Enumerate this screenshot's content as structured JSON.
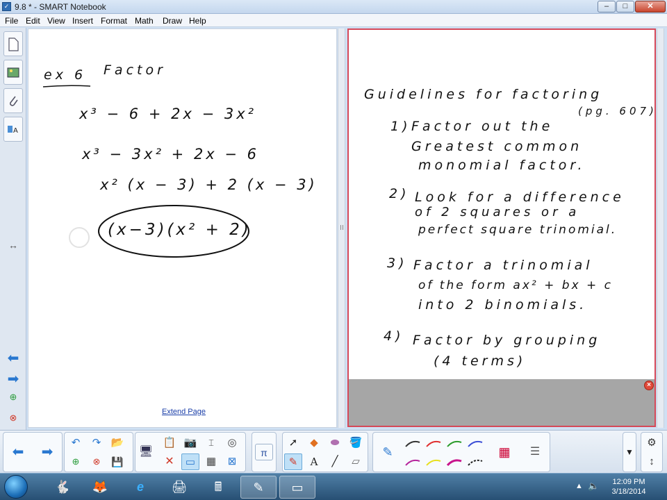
{
  "window": {
    "title": "9.8 * - SMART Notebook"
  },
  "menu": [
    "File",
    "Edit",
    "View",
    "Insert",
    "Format",
    "Math",
    "Draw",
    "Help"
  ],
  "left_page": {
    "ex_label": "ex 6",
    "factor_label": "Factor",
    "line1": "x³ − 6 + 2x − 3x²",
    "line2": "x³ − 3x² + 2x − 6",
    "line3": "x² (x − 3) + 2 (x − 3)",
    "answer": "(x−3)(x² + 2)",
    "extend_link": "Extend Page"
  },
  "right_page": {
    "heading": "Guidelines for factoring",
    "ref": "(pg. 607)",
    "items": [
      {
        "num": "1)",
        "lines": [
          "Factor out the",
          "Greatest common",
          "monomial factor."
        ]
      },
      {
        "num": "2)",
        "lines": [
          "Look for a difference",
          "of 2 squares or a",
          "perfect square trinomial."
        ]
      },
      {
        "num": "3)",
        "lines": [
          "Factor a trinomial",
          "of the form ax² + bx + c",
          "into 2 binomials."
        ]
      },
      {
        "num": "4)",
        "lines": [
          "Factor by grouping",
          "(4 terms)"
        ]
      }
    ]
  },
  "taskbar": {
    "time": "12:09 PM",
    "date": "3/18/2014"
  },
  "colors": {
    "page_border_active": "#d64858",
    "pen_colors": [
      "#333333",
      "#e03030",
      "#2c9c2c",
      "#3c4fd6",
      "#b5259c",
      "#e8e020",
      "#c8148c",
      "#222222"
    ]
  }
}
